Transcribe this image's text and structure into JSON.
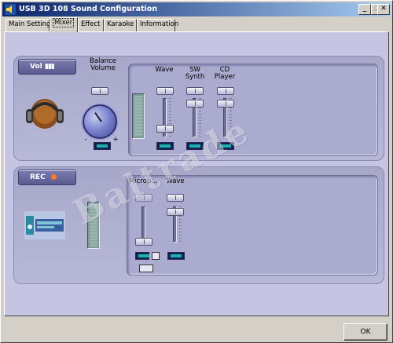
{
  "window": {
    "title": "USB 3D 108 Sound Configuration"
  },
  "tabs": [
    {
      "label": "Main Setting"
    },
    {
      "label": "Mixer",
      "active": true
    },
    {
      "label": "Effect"
    },
    {
      "label": "Karaoke"
    },
    {
      "label": "Information"
    }
  ],
  "vol_group": {
    "header": "Vol",
    "balance_label": "Balance Volume",
    "knob_left_label": "-",
    "knob_right_label": "+",
    "channels": [
      {
        "label": "Wave"
      },
      {
        "label": "SW Synth"
      },
      {
        "label": "CD Player"
      }
    ]
  },
  "rec_group": {
    "header": "REC",
    "channels": [
      {
        "label": "Microp..."
      },
      {
        "label": "Wave"
      }
    ]
  },
  "watermark": "Baltrade",
  "ok_label": "OK",
  "colors": {
    "title_bar": "#0a246a",
    "panel": "#c5c5e3",
    "accent_teal": "#20b2aa"
  }
}
